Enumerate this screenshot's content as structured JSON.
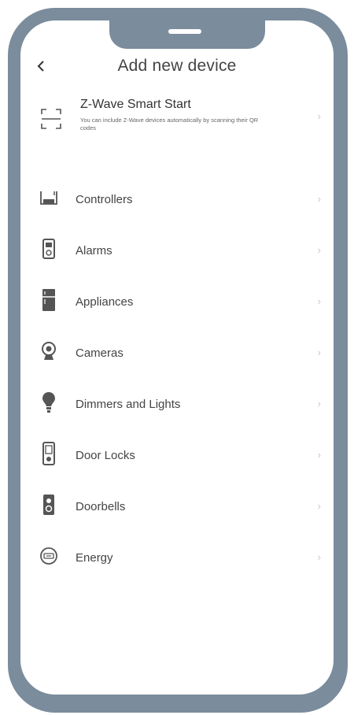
{
  "header": {
    "title": "Add new device",
    "back_icon": "chevron-left-icon"
  },
  "smart_start": {
    "title": "Z-Wave Smart Start",
    "description": "You can include Z-Wave devices automatically by scanning their QR codes",
    "icon": "qr-scan-icon"
  },
  "categories": [
    {
      "label": "Controllers",
      "icon": "controller-icon"
    },
    {
      "label": "Alarms",
      "icon": "alarm-icon"
    },
    {
      "label": "Appliances",
      "icon": "appliance-icon"
    },
    {
      "label": "Cameras",
      "icon": "camera-icon"
    },
    {
      "label": "Dimmers and Lights",
      "icon": "bulb-icon"
    },
    {
      "label": "Door Locks",
      "icon": "door-lock-icon"
    },
    {
      "label": "Doorbells",
      "icon": "doorbell-icon"
    },
    {
      "label": "Energy",
      "icon": "energy-icon"
    }
  ],
  "colors": {
    "frame": "#7b8c9c",
    "icon": "#555555",
    "chevron": "#c8c8c8"
  }
}
